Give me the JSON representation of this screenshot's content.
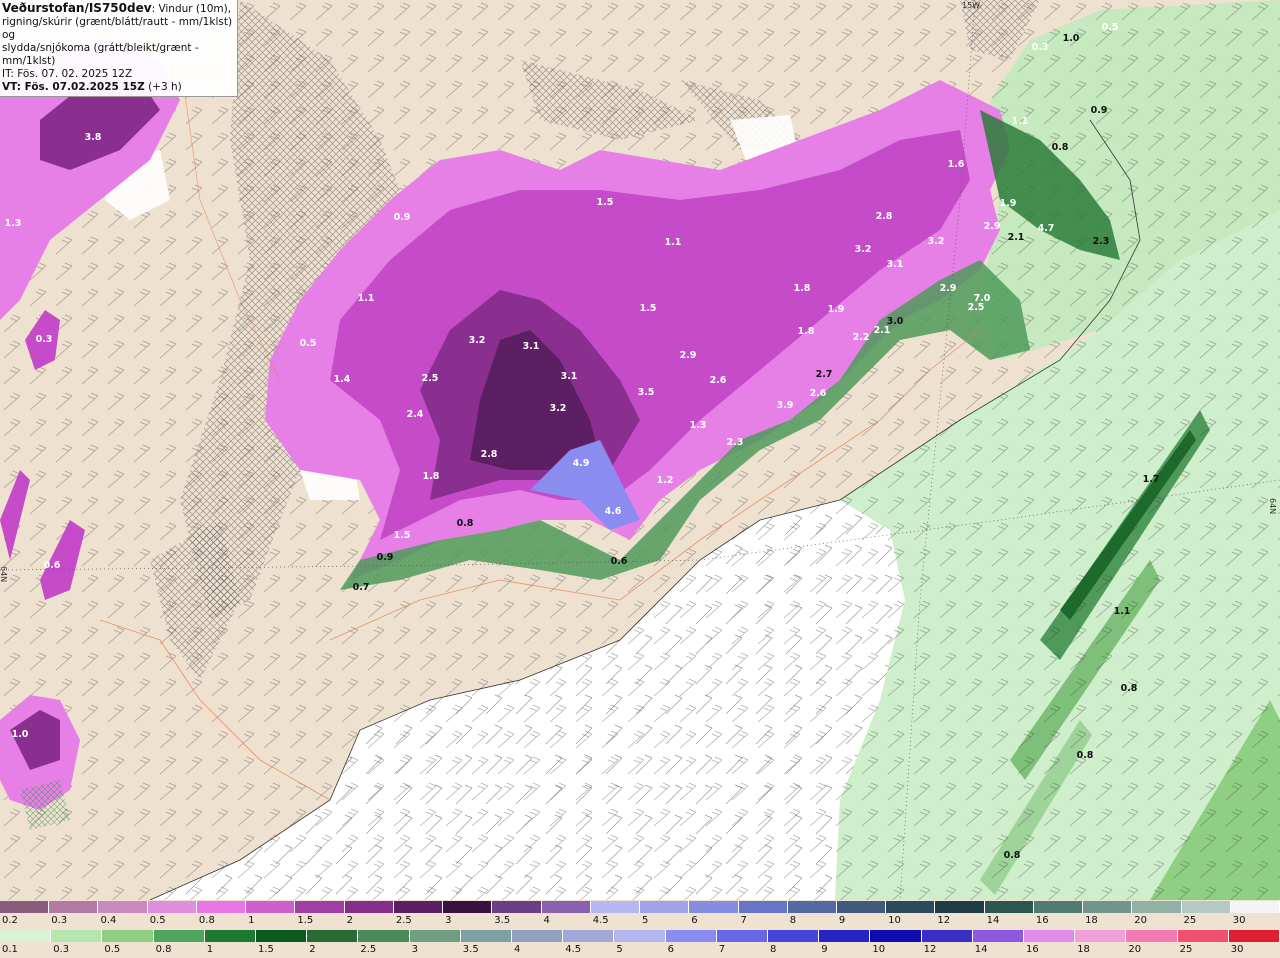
{
  "header": {
    "title": "Veðurstofan/IS750dev",
    "desc_line1": ": Vindur (10m),",
    "desc_line2": "rigning/skúrir (grænt/blátt/rautt - mm/1klst) og",
    "desc_line3": "slydda/snjókoma (grátt/bleikt/grænt - mm/1klst)",
    "init_time": "IT: Fös. 07. 02. 2025 12Z",
    "valid_time": "VT: Fös. 07.02.2025 15Z",
    "valid_offset": "(+3 h)"
  },
  "grid_labels": {
    "lon": "15W",
    "lat_left": "64N",
    "lat_right": "64N"
  },
  "map_values": [
    {
      "v": "3.8",
      "dark": false
    },
    {
      "v": "1.3",
      "dark": false
    },
    {
      "v": "0.3",
      "dark": false
    },
    {
      "v": "0.9",
      "dark": false
    },
    {
      "v": "1.1",
      "dark": false
    },
    {
      "v": "0.5",
      "dark": false
    },
    {
      "v": "1.4",
      "dark": false
    },
    {
      "v": "3.2",
      "dark": false
    },
    {
      "v": "3.1",
      "dark": false
    },
    {
      "v": "2.5",
      "dark": false
    },
    {
      "v": "3.1",
      "dark": false
    },
    {
      "v": "2.4",
      "dark": false
    },
    {
      "v": "3.2",
      "dark": false
    },
    {
      "v": "2.8",
      "dark": false
    },
    {
      "v": "1.8",
      "dark": false
    },
    {
      "v": "4.9",
      "dark": false
    },
    {
      "v": "4.6",
      "dark": false
    },
    {
      "v": "0.8",
      "dark": true
    },
    {
      "v": "1.5",
      "dark": false
    },
    {
      "v": "0.9",
      "dark": true
    },
    {
      "v": "0.7",
      "dark": true
    },
    {
      "v": "0.6",
      "dark": true
    },
    {
      "v": "1.5",
      "dark": false
    },
    {
      "v": "3.5",
      "dark": false
    },
    {
      "v": "2.9",
      "dark": false
    },
    {
      "v": "2.6",
      "dark": false
    },
    {
      "v": "1.1",
      "dark": false
    },
    {
      "v": "1.8",
      "dark": false
    },
    {
      "v": "1.2",
      "dark": false
    },
    {
      "v": "1.3",
      "dark": false
    },
    {
      "v": "2.3",
      "dark": false
    },
    {
      "v": "3.9",
      "dark": false
    },
    {
      "v": "2.6",
      "dark": false
    },
    {
      "v": "2.7",
      "dark": true
    },
    {
      "v": "1.8",
      "dark": false
    },
    {
      "v": "1.9",
      "dark": false
    },
    {
      "v": "2.2",
      "dark": false
    },
    {
      "v": "2.1",
      "dark": false
    },
    {
      "v": "3.0",
      "dark": true
    },
    {
      "v": "2.8",
      "dark": false
    },
    {
      "v": "3.2",
      "dark": false
    },
    {
      "v": "3.1",
      "dark": false
    },
    {
      "v": "3.2",
      "dark": false
    },
    {
      "v": "2.9",
      "dark": false
    },
    {
      "v": "7.0",
      "dark": false
    },
    {
      "v": "2.5",
      "dark": false
    },
    {
      "v": "1.6",
      "dark": false
    },
    {
      "v": "2.9",
      "dark": false
    },
    {
      "v": "1.9",
      "dark": false
    },
    {
      "v": "4.7",
      "dark": false
    },
    {
      "v": "2.3",
      "dark": true
    },
    {
      "v": "0.9",
      "dark": true
    },
    {
      "v": "1.0",
      "dark": true
    },
    {
      "v": "0.3",
      "dark": false
    },
    {
      "v": "0.5",
      "dark": false
    },
    {
      "v": "1.7",
      "dark": true
    },
    {
      "v": "1.1",
      "dark": true
    },
    {
      "v": "0.8",
      "dark": true
    },
    {
      "v": "0.8",
      "dark": true
    },
    {
      "v": "0.8",
      "dark": true
    },
    {
      "v": "1.0",
      "dark": false
    },
    {
      "v": "0.6",
      "dark": false
    },
    {
      "v": "1.5",
      "dark": false
    },
    {
      "v": "1.1",
      "dark": false
    },
    {
      "v": "0.8",
      "dark": true
    },
    {
      "v": "2.1",
      "dark": true
    }
  ],
  "legend_snow": {
    "labels": [
      "0.2",
      "0.3",
      "0.4",
      "0.5",
      "0.8",
      "1",
      "1.5",
      "2",
      "2.5",
      "3",
      "3.5",
      "4",
      "4.5",
      "5",
      "6",
      "7",
      "8",
      "9",
      "10",
      "12",
      "14",
      "16",
      "18",
      "20",
      "25",
      "30"
    ],
    "colors": [
      "#8a5c7c",
      "#b07aa4",
      "#c98ac0",
      "#e08ee0",
      "#e876e8",
      "#cf5ecf",
      "#a13ea5",
      "#862d8a",
      "#5c1f63",
      "#3a0f42",
      "#6a3d85",
      "#8a60b0",
      "#b5b8f2",
      "#9fa4ea",
      "#858de0",
      "#6874c8",
      "#526aa4",
      "#3f5a7e",
      "#2b4a5c",
      "#1e3d44",
      "#2c5652",
      "#4f7a72",
      "#6e968b",
      "#90b1a4",
      "#b4c9c4",
      "#f4f4f4"
    ]
  },
  "legend_rain": {
    "labels": [
      "0.1",
      "0.3",
      "0.5",
      "0.8",
      "1",
      "1.5",
      "2",
      "2.5",
      "3",
      "3.5",
      "4",
      "4.5",
      "5",
      "6",
      "7",
      "8",
      "9",
      "10",
      "12",
      "14",
      "16",
      "18",
      "20",
      "25",
      "30"
    ],
    "colors": [
      "#d8f3d4",
      "#b6e6ad",
      "#8fcf83",
      "#4fa55b",
      "#1d7a30",
      "#0c5a1d",
      "#2a6b35",
      "#4b8a5a",
      "#6f9f80",
      "#7e9fa6",
      "#91a3c1",
      "#a2a8d6",
      "#b4b8ee",
      "#8a8cf0",
      "#6668e6",
      "#4446da",
      "#2525c4",
      "#0d0db0",
      "#3a2ec4",
      "#8c58e0",
      "#e38bec",
      "#f0a0d8",
      "#f27ab4",
      "#f0506e",
      "#e01e32"
    ]
  }
}
